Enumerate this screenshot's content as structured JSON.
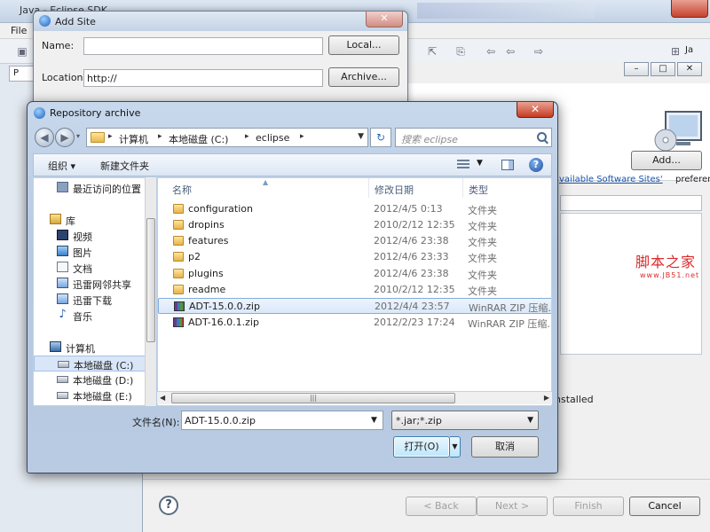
{
  "eclipse": {
    "title": "Java - Eclipse SDK",
    "menu_file": "File",
    "perspective_label": "Ja",
    "left_tab_label": "P"
  },
  "install_dialog": {
    "minimize": "–",
    "maximize": "□",
    "close": "✕",
    "add_button": "Add...",
    "available_sites_link": "vailable Software Sites'",
    "preferences_text": "preferences.",
    "watermark_text": "脚本之家",
    "watermark_url": "www.JB51.net",
    "installed_text": "nstalled",
    "back_button": "< Back",
    "next_button": "Next >",
    "finish_button": "Finish",
    "cancel_button": "Cancel"
  },
  "add_site": {
    "title": "Add Site",
    "close": "✕",
    "name_label": "Name:",
    "name_value": "",
    "location_label": "Location:",
    "location_value": "http://",
    "local_button": "Local...",
    "archive_button": "Archive..."
  },
  "repo_archive": {
    "title": "Repository archive",
    "close": "✕",
    "breadcrumb": [
      "计算机",
      "本地磁盘 (C:)",
      "eclipse"
    ],
    "search_placeholder": "搜索 eclipse",
    "organize": "组织 ▾",
    "new_folder": "新建文件夹",
    "tree": [
      {
        "label": "最近访问的位置",
        "icon": "recent-places-icon"
      },
      {
        "label": "库",
        "icon": "library-icon"
      },
      {
        "label": "视频",
        "icon": "video-icon"
      },
      {
        "label": "图片",
        "icon": "pictures-icon"
      },
      {
        "label": "文档",
        "icon": "documents-icon"
      },
      {
        "label": "迅雷网邻共享",
        "icon": "share-icon"
      },
      {
        "label": "迅雷下载",
        "icon": "download-icon"
      },
      {
        "label": "音乐",
        "icon": "music-icon"
      },
      {
        "label": "计算机",
        "icon": "computer-icon"
      },
      {
        "label": "本地磁盘 (C:)",
        "icon": "drive-icon"
      },
      {
        "label": "本地磁盘 (D:)",
        "icon": "drive-icon"
      },
      {
        "label": "本地磁盘 (E:)",
        "icon": "drive-icon"
      }
    ],
    "columns": [
      "名称",
      "修改日期",
      "类型"
    ],
    "files": [
      {
        "name": "configuration",
        "date": "2012/4/5 0:13",
        "type": "文件夹",
        "kind": "folder"
      },
      {
        "name": "dropins",
        "date": "2010/2/12 12:35",
        "type": "文件夹",
        "kind": "folder"
      },
      {
        "name": "features",
        "date": "2012/4/6 23:38",
        "type": "文件夹",
        "kind": "folder"
      },
      {
        "name": "p2",
        "date": "2012/4/6 23:33",
        "type": "文件夹",
        "kind": "folder"
      },
      {
        "name": "plugins",
        "date": "2012/4/6 23:38",
        "type": "文件夹",
        "kind": "folder"
      },
      {
        "name": "readme",
        "date": "2010/2/12 12:35",
        "type": "文件夹",
        "kind": "folder"
      },
      {
        "name": "ADT-15.0.0.zip",
        "date": "2012/4/4 23:57",
        "type": "WinRAR ZIP 压缩...",
        "kind": "zip"
      },
      {
        "name": "ADT-16.0.1.zip",
        "date": "2012/2/23 17:24",
        "type": "WinRAR ZIP 压缩...",
        "kind": "zip"
      }
    ],
    "selected_file_index": 6,
    "selected_tree_index": 9,
    "filename_label": "文件名(N):",
    "filename_value": "ADT-15.0.0.zip",
    "filter_value": "*.jar;*.zip",
    "open_button": "打开(O)",
    "cancel_button": "取消"
  }
}
